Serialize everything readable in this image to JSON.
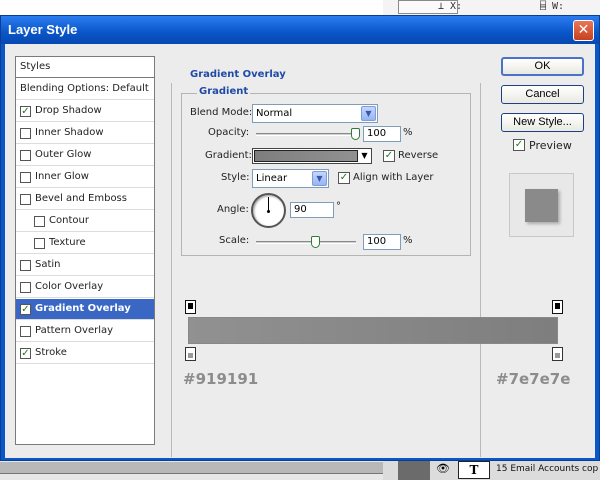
{
  "dialog": {
    "title": "Layer Style",
    "close_glyph": "✕"
  },
  "styles_list": {
    "header": "Styles",
    "items": [
      {
        "label": "Blending Options: Default",
        "checkbox": false,
        "checked": false,
        "indent": 0
      },
      {
        "label": "Drop Shadow",
        "checkbox": true,
        "checked": true,
        "indent": 0
      },
      {
        "label": "Inner Shadow",
        "checkbox": true,
        "checked": false,
        "indent": 0
      },
      {
        "label": "Outer Glow",
        "checkbox": true,
        "checked": false,
        "indent": 0
      },
      {
        "label": "Inner Glow",
        "checkbox": true,
        "checked": false,
        "indent": 0
      },
      {
        "label": "Bevel and Emboss",
        "checkbox": true,
        "checked": false,
        "indent": 0
      },
      {
        "label": "Contour",
        "checkbox": true,
        "checked": false,
        "indent": 1
      },
      {
        "label": "Texture",
        "checkbox": true,
        "checked": false,
        "indent": 1
      },
      {
        "label": "Satin",
        "checkbox": true,
        "checked": false,
        "indent": 0
      },
      {
        "label": "Color Overlay",
        "checkbox": true,
        "checked": false,
        "indent": 0
      },
      {
        "label": "Gradient Overlay",
        "checkbox": true,
        "checked": true,
        "indent": 0,
        "selected": true
      },
      {
        "label": "Pattern Overlay",
        "checkbox": true,
        "checked": false,
        "indent": 0
      },
      {
        "label": "Stroke",
        "checkbox": true,
        "checked": true,
        "indent": 0
      }
    ]
  },
  "gradient_overlay": {
    "section_title": "Gradient Overlay",
    "group_title": "Gradient",
    "blend_mode": {
      "label": "Blend Mode:",
      "value": "Normal"
    },
    "opacity": {
      "label": "Opacity:",
      "value": "100",
      "unit": "%",
      "level": 100
    },
    "gradient": {
      "label": "Gradient:",
      "reverse_label": "Reverse",
      "reverse_checked": true
    },
    "style": {
      "label": "Style:",
      "value": "Linear",
      "align_label": "Align with Layer",
      "align_checked": true
    },
    "angle": {
      "label": "Angle:",
      "value": "90",
      "unit": "°"
    },
    "scale": {
      "label": "Scale:",
      "value": "100",
      "unit": "%",
      "level": 100
    }
  },
  "gradient_editor": {
    "left_color": "#919191",
    "right_color": "#7e7e7e"
  },
  "buttons": {
    "ok": "OK",
    "cancel": "Cancel",
    "new_style": "New Style...",
    "preview_label": "Preview",
    "preview_checked": true
  },
  "background": {
    "layer_name": "15 Email Accounts cop",
    "type_glyph": "T",
    "eye_glyph": "👁",
    "top_glyph_a": "⊥ X:",
    "top_glyph_b": "⌸ W:"
  },
  "colors": {
    "title_bar": "#0a57c7",
    "selection": "#3a67c4",
    "section_title": "#1f4aa7",
    "dialog_bg": "#ececec"
  },
  "check_glyph": "✓"
}
